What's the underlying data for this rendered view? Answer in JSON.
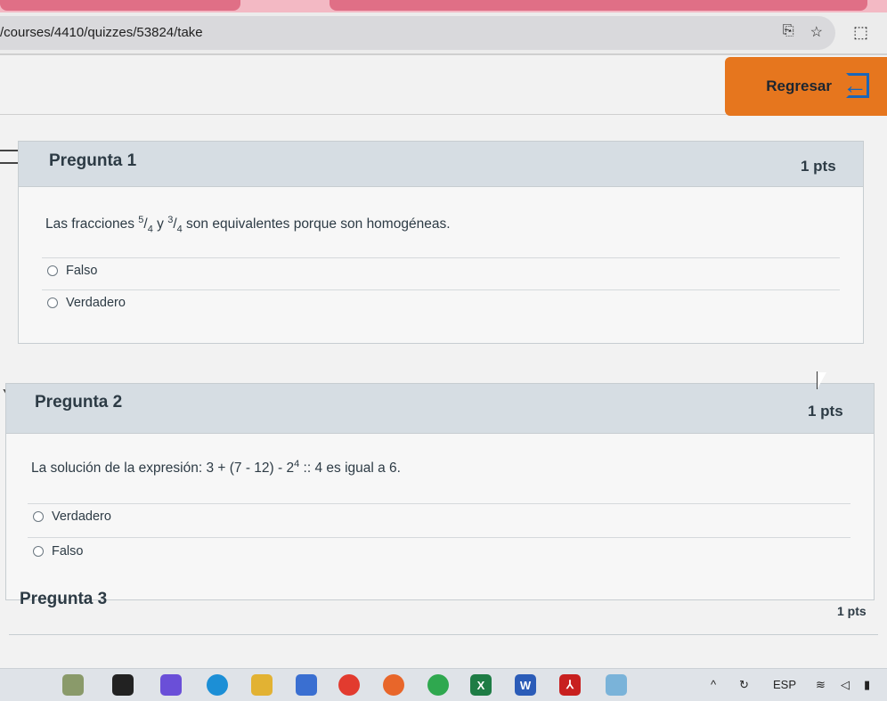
{
  "browser": {
    "url": "/courses/4410/quizzes/53824/take"
  },
  "header": {
    "back_label": "Regresar"
  },
  "questions": [
    {
      "title": "Pregunta 1",
      "points": "1 pts",
      "text_prefix": "Las fracciones ",
      "frac1_num": "5",
      "frac1_den": "4",
      "conj": " y ",
      "frac2_num": "3",
      "frac2_den": "4",
      "text_suffix": " son equivalentes porque son homogéneas.",
      "options": [
        "Falso",
        "Verdadero"
      ]
    },
    {
      "title": "Pregunta 2",
      "points": "1 pts",
      "text_prefix": "La solución de la expresión: ",
      "expr_a": "3 + (7 - 12) - 2",
      "expr_exp": "4",
      "expr_b": " :: 4",
      "text_suffix": " es igual a 6.",
      "options": [
        "Verdadero",
        "Falso"
      ]
    },
    {
      "title": "Pregunta 3",
      "points": "1 pts"
    }
  ],
  "taskbar": {
    "language": "ESP"
  }
}
